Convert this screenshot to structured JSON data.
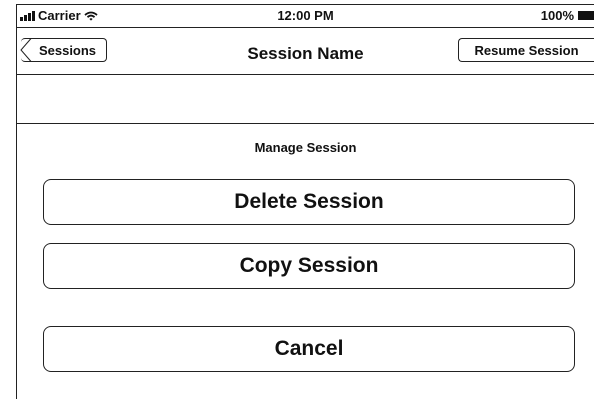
{
  "status_bar": {
    "carrier": "Carrier",
    "time": "12:00 PM",
    "battery": "100%"
  },
  "nav_bar": {
    "back_label": "Sessions",
    "title": "Session Name",
    "action_label": "Resume Session"
  },
  "action_sheet": {
    "title": "Manage Session",
    "delete_label": "Delete Session",
    "copy_label": "Copy Session",
    "cancel_label": "Cancel"
  }
}
